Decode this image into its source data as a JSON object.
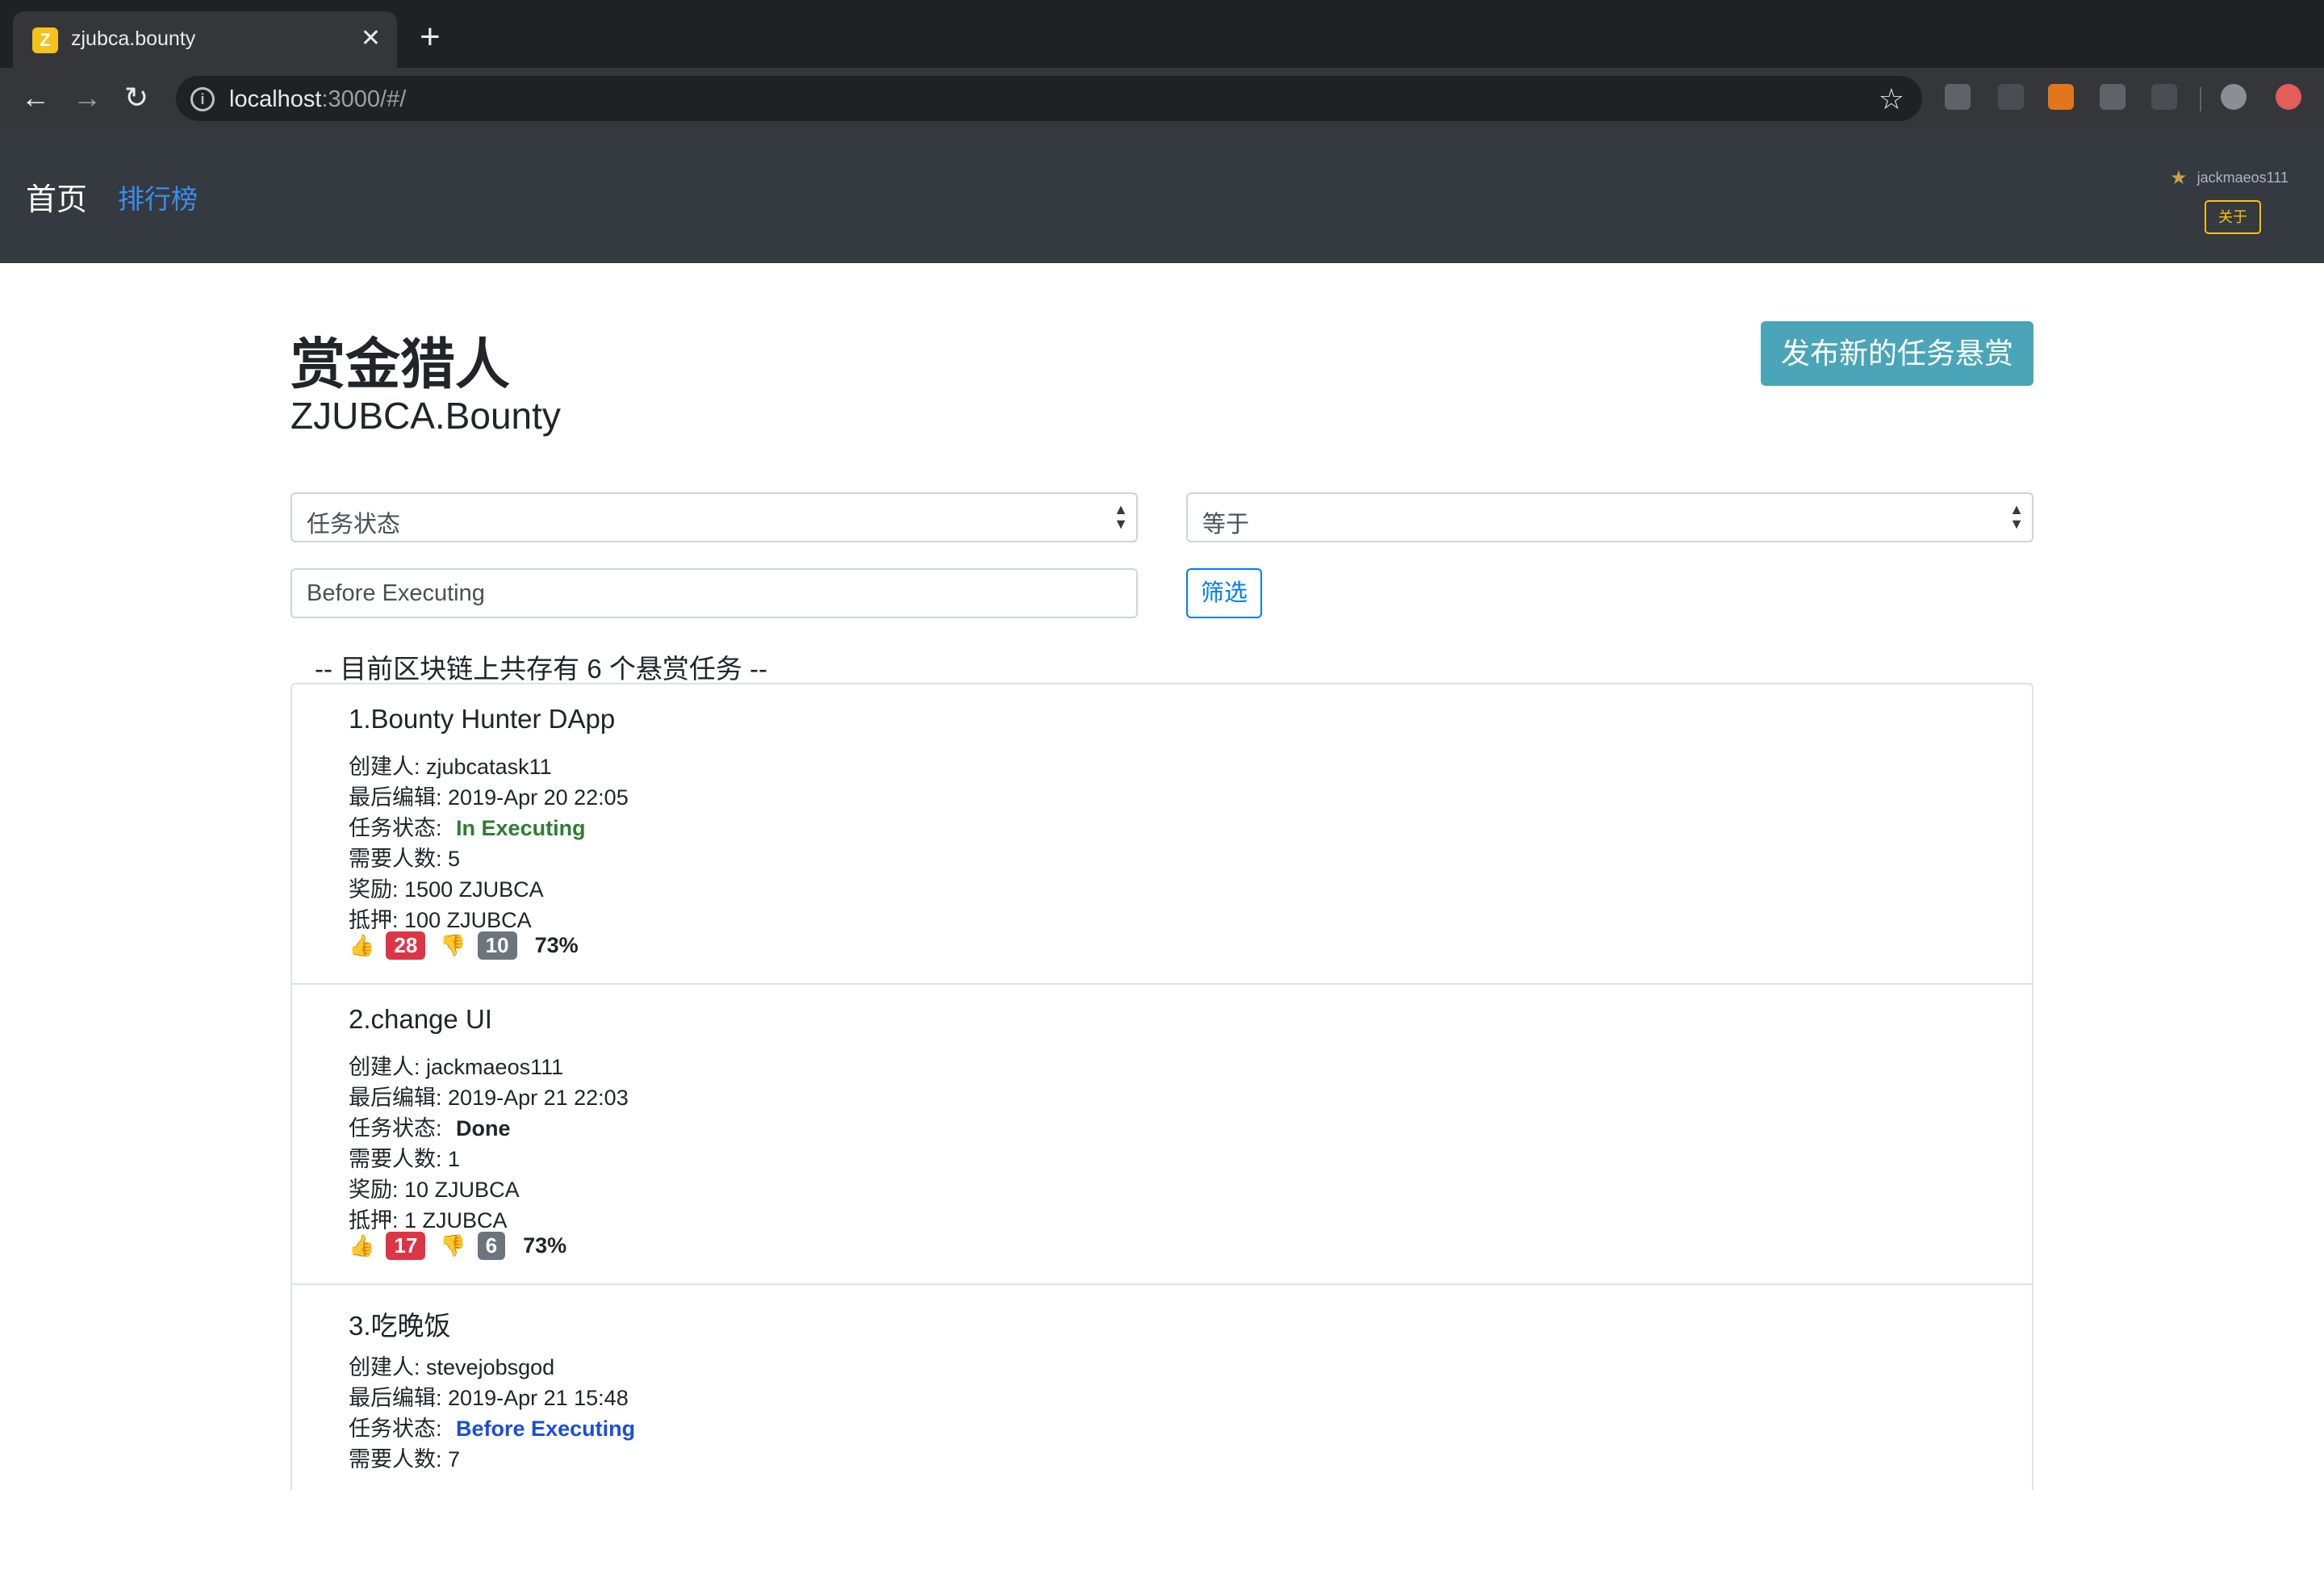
{
  "browser": {
    "tab_title": "zjubca.bounty",
    "favicon_letter": "Z",
    "close_glyph": "✕",
    "newtab_glyph": "+",
    "url_host": "localhost",
    "url_rest": ":3000/#/",
    "back_glyph": "←",
    "forward_glyph": "→",
    "reload_glyph": "↻",
    "star_glyph": "☆"
  },
  "nav": {
    "brand": "首页",
    "rank_link": "排行榜",
    "username": "jackmaeos111",
    "about_label": "关于"
  },
  "header": {
    "title": "赏金猎人",
    "subtitle": "ZJUBCA.Bounty",
    "publish_button": "发布新的任务悬赏"
  },
  "filter": {
    "field_select": "任务状态",
    "operator_select": "等于",
    "value_input": "Before Executing",
    "filter_button": "筛选"
  },
  "summary": "-- 目前区块链上共存有 6 个悬赏任务 --",
  "labels": {
    "creator": "创建人:",
    "last_edit": "最后编辑:",
    "status": "任务状态:",
    "needed": "需要人数:",
    "reward": "奖励:",
    "deposit": "抵押:"
  },
  "tasks": [
    {
      "title": "1.Bounty Hunter DApp",
      "creator": "zjubcatask11",
      "last_edit": "2019-Apr 20 22:05",
      "status": "In Executing",
      "needed": "5",
      "reward": "1500 ZJUBCA",
      "deposit": "100 ZJUBCA",
      "upvotes": "28",
      "downvotes": "10",
      "ratio": "73%"
    },
    {
      "title": "2.change UI",
      "creator": "jackmaeos111",
      "last_edit": "2019-Apr 21 22:03",
      "status": "Done",
      "needed": "1",
      "reward": "10 ZJUBCA",
      "deposit": "1 ZJUBCA",
      "upvotes": "17",
      "downvotes": "6",
      "ratio": "73%"
    },
    {
      "title": "3.吃晚饭",
      "creator": "stevejobsgod",
      "last_edit": "2019-Apr 21 15:48",
      "status": "Before Executing",
      "needed": "7"
    }
  ],
  "colors": {
    "status_executing": "#2e7d32",
    "status_done": "#212529",
    "status_before": "#1a4ed8",
    "upvote_badge": "#dc3545",
    "downvote_badge": "#6c757d",
    "publish_button": "#4aa5b8"
  }
}
